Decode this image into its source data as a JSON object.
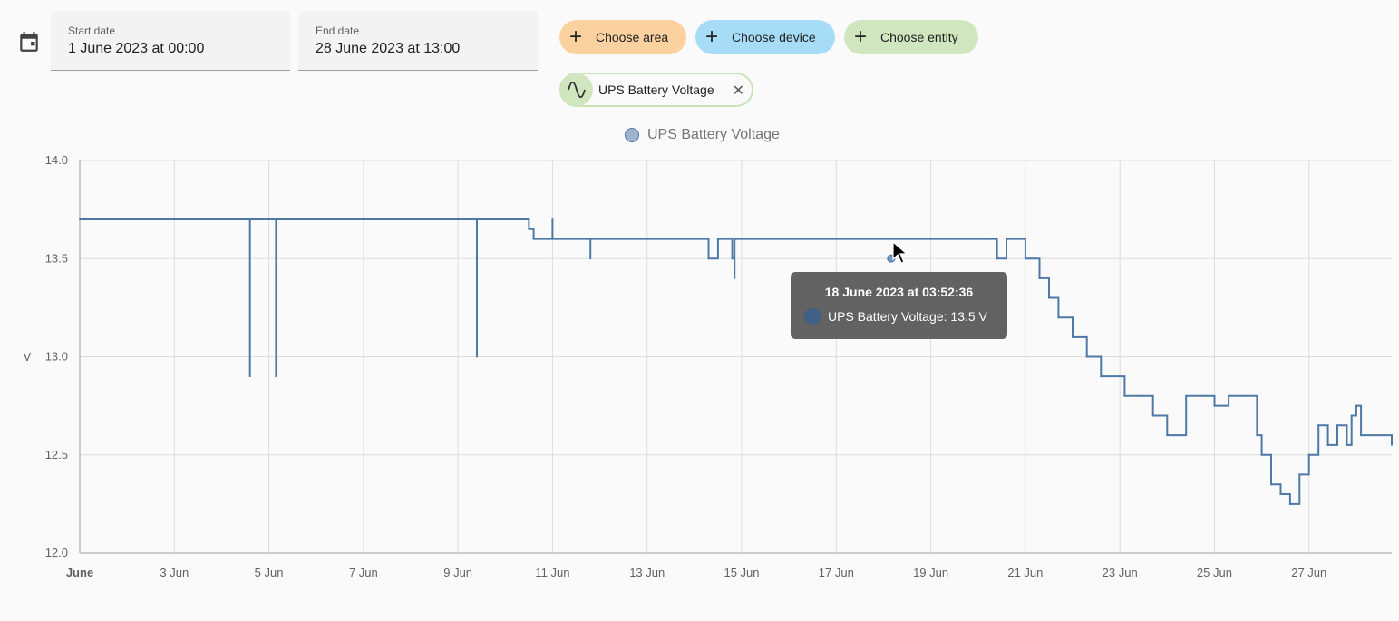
{
  "date_range": {
    "start_label": "Start date",
    "start_value": "1 June 2023 at 00:00",
    "end_label": "End date",
    "end_value": "28 June 2023 at 13:00"
  },
  "chips": {
    "area": "Choose area",
    "device": "Choose device",
    "entity": "Choose entity"
  },
  "selected_entity": {
    "label": "UPS Battery Voltage",
    "icon": "sine-wave-icon"
  },
  "colors": {
    "series": "#4e79a7",
    "area_chip": "#fcd1a0",
    "device_chip": "#a7dcf7",
    "entity_chip": "#cfe6bf"
  },
  "tooltip": {
    "time": "18 June 2023 at 03:52:36",
    "line": "UPS Battery Voltage: 13.5 V"
  },
  "chart_data": {
    "type": "line",
    "ylabel": "V",
    "ylim": [
      12.0,
      14.0
    ],
    "yticks": [
      12.0,
      12.5,
      13.0,
      13.5,
      14.0
    ],
    "ytick_labels": [
      "12.0",
      "12.5",
      "13.0",
      "13.5",
      "14.0"
    ],
    "xlim": [
      1,
      28.75
    ],
    "xticks": [
      1,
      3,
      5,
      7,
      9,
      11,
      13,
      15,
      17,
      19,
      21,
      23,
      25,
      27
    ],
    "xtick_labels": [
      "June",
      "3 Jun",
      "5 Jun",
      "7 Jun",
      "9 Jun",
      "11 Jun",
      "13 Jun",
      "15 Jun",
      "17 Jun",
      "19 Jun",
      "21 Jun",
      "23 Jun",
      "25 Jun",
      "27 Jun"
    ],
    "series": [
      {
        "name": "UPS Battery Voltage",
        "x": [
          1,
          4.6,
          4.6,
          4.6,
          5.15,
          5.15,
          5.15,
          9.4,
          9.4,
          9.4,
          9.8,
          10.5,
          10.6,
          11.0,
          11.0,
          11.0,
          11.8,
          11.8,
          11.8,
          14.0,
          14.3,
          14.5,
          14.8,
          14.85,
          14.85,
          14.9,
          15.6,
          18.0,
          20.2,
          20.4,
          20.6,
          20.9,
          21.0,
          21.1,
          21.3,
          21.5,
          21.7,
          22.0,
          22.3,
          22.6,
          22.9,
          23.1,
          23.4,
          23.7,
          24.0,
          24.4,
          24.8,
          25.0,
          25.3,
          25.6,
          25.9,
          26.0,
          26.2,
          26.4,
          26.6,
          26.8,
          27.0,
          27.2,
          27.4,
          27.6,
          27.8,
          27.9,
          28.0,
          28.1,
          28.75
        ],
        "y": [
          13.7,
          13.7,
          12.9,
          13.7,
          13.7,
          12.9,
          13.7,
          13.7,
          13.0,
          13.7,
          13.7,
          13.65,
          13.6,
          13.6,
          13.7,
          13.6,
          13.6,
          13.5,
          13.6,
          13.6,
          13.5,
          13.6,
          13.5,
          13.4,
          13.6,
          13.6,
          13.6,
          13.6,
          13.6,
          13.5,
          13.6,
          13.6,
          13.5,
          13.5,
          13.4,
          13.3,
          13.2,
          13.1,
          13.0,
          12.9,
          12.9,
          12.8,
          12.8,
          12.7,
          12.6,
          12.8,
          12.8,
          12.75,
          12.8,
          12.8,
          12.6,
          12.5,
          12.35,
          12.3,
          12.25,
          12.4,
          12.5,
          12.65,
          12.55,
          12.65,
          12.55,
          12.7,
          12.75,
          12.6,
          12.55
        ]
      }
    ]
  }
}
